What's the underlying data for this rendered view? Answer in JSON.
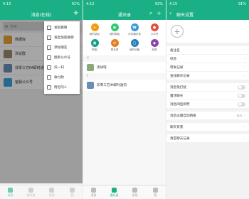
{
  "colors": {
    "accent": "#1aaf85"
  },
  "phone1": {
    "status": {
      "time": "4:13",
      "battery": "91%"
    },
    "title": "消息(在线)",
    "search_placeholder": "搜索",
    "messages": [
      {
        "name": "数据库",
        "color": "#e7a23a"
      },
      {
        "name": "测试群",
        "color": "#9b8b6a"
      },
      {
        "name": "非零三方IM即时通讯",
        "color": "#6a8fb5"
      },
      {
        "name": "客服公众号",
        "color": "#3aa0e0"
      }
    ],
    "menu": [
      "发起群聊",
      "发起加密群聊",
      "添加朋友",
      "搜索公众号",
      "扫一扫",
      "收付款",
      "附近的人"
    ],
    "tabs": [
      "消息",
      "通讯录",
      "发现",
      "我"
    ]
  },
  "phone2": {
    "status": {
      "time": "4:13",
      "battery": "92%"
    },
    "title": "通讯录",
    "grid": [
      {
        "label": "新的朋友",
        "color": "#f39c12"
      },
      {
        "label": "我的群组",
        "color": "#2ecc71"
      },
      {
        "label": "手机通讯录",
        "color": "#3498db"
      },
      {
        "label": "公众号",
        "color": "#e74c3c"
      },
      {
        "label": "群组",
        "color": "#16a085"
      },
      {
        "label": "黑名单",
        "color": "#e67e22"
      },
      {
        "label": "我的设备",
        "color": "#2980b9"
      },
      {
        "label": "标签",
        "color": "#8e44ad"
      }
    ],
    "sections": [
      {
        "letter": "C",
        "contacts": [
          "测试呀"
        ]
      },
      {
        "letter": "F",
        "contacts": [
          "非零三方IM即时通讯"
        ]
      }
    ],
    "tabs": [
      "消息",
      "通讯录",
      "发现",
      "我"
    ]
  },
  "phone3": {
    "status": {
      "time": "4:15",
      "battery": "91%"
    },
    "title": "聊天设置",
    "rows1": [
      "备注名",
      "标签",
      "转发记录",
      "查找聊天记录"
    ],
    "rows2": [
      "消息免打扰",
      "置顶聊天",
      "消息阅后即焚"
    ],
    "rows3": [
      {
        "label": "消息过期自动销毁",
        "value": "永久"
      }
    ],
    "rows4": [
      "聊天背景",
      "清空聊天记录"
    ]
  }
}
